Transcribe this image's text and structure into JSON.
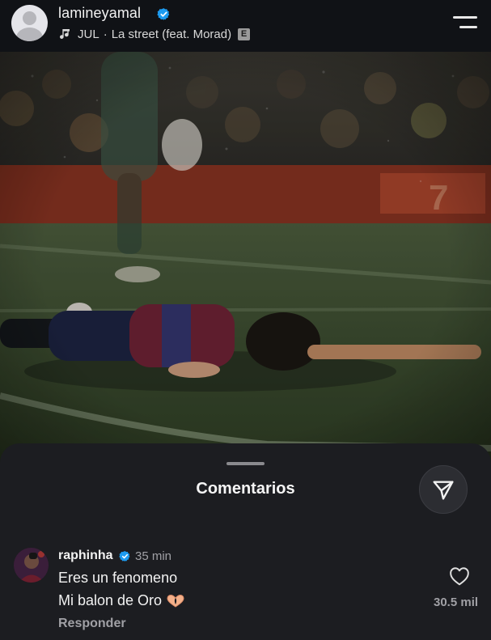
{
  "story_header": {
    "username": "lamineyamal",
    "music_artist": "JUL",
    "music_separator": "·",
    "music_title": "La street (feat. Morad)",
    "explicit_badge": "E",
    "icons": {
      "avatar": "default-avatar-icon",
      "verified": "verified-badge-icon",
      "music": "music-note-icon",
      "menu": "menu-icon"
    }
  },
  "photo": {
    "subject": "player-lying-on-pitch-image"
  },
  "comments_sheet": {
    "title": "Comentarios",
    "share_icon": "send-icon",
    "comments": [
      {
        "author": "raphinha",
        "time": "35 min",
        "line1": "Eres un fenomeno",
        "line2": "Mi balon de Oro",
        "emoji": "heart-hands-icon",
        "reply_label": "Responder",
        "likes": "30.5 mil"
      }
    ]
  },
  "colors": {
    "background": "#0b0c0e",
    "sheet": "#1c1d21",
    "verified": "#1d9bf0",
    "muted_text": "#a0a0a5"
  }
}
